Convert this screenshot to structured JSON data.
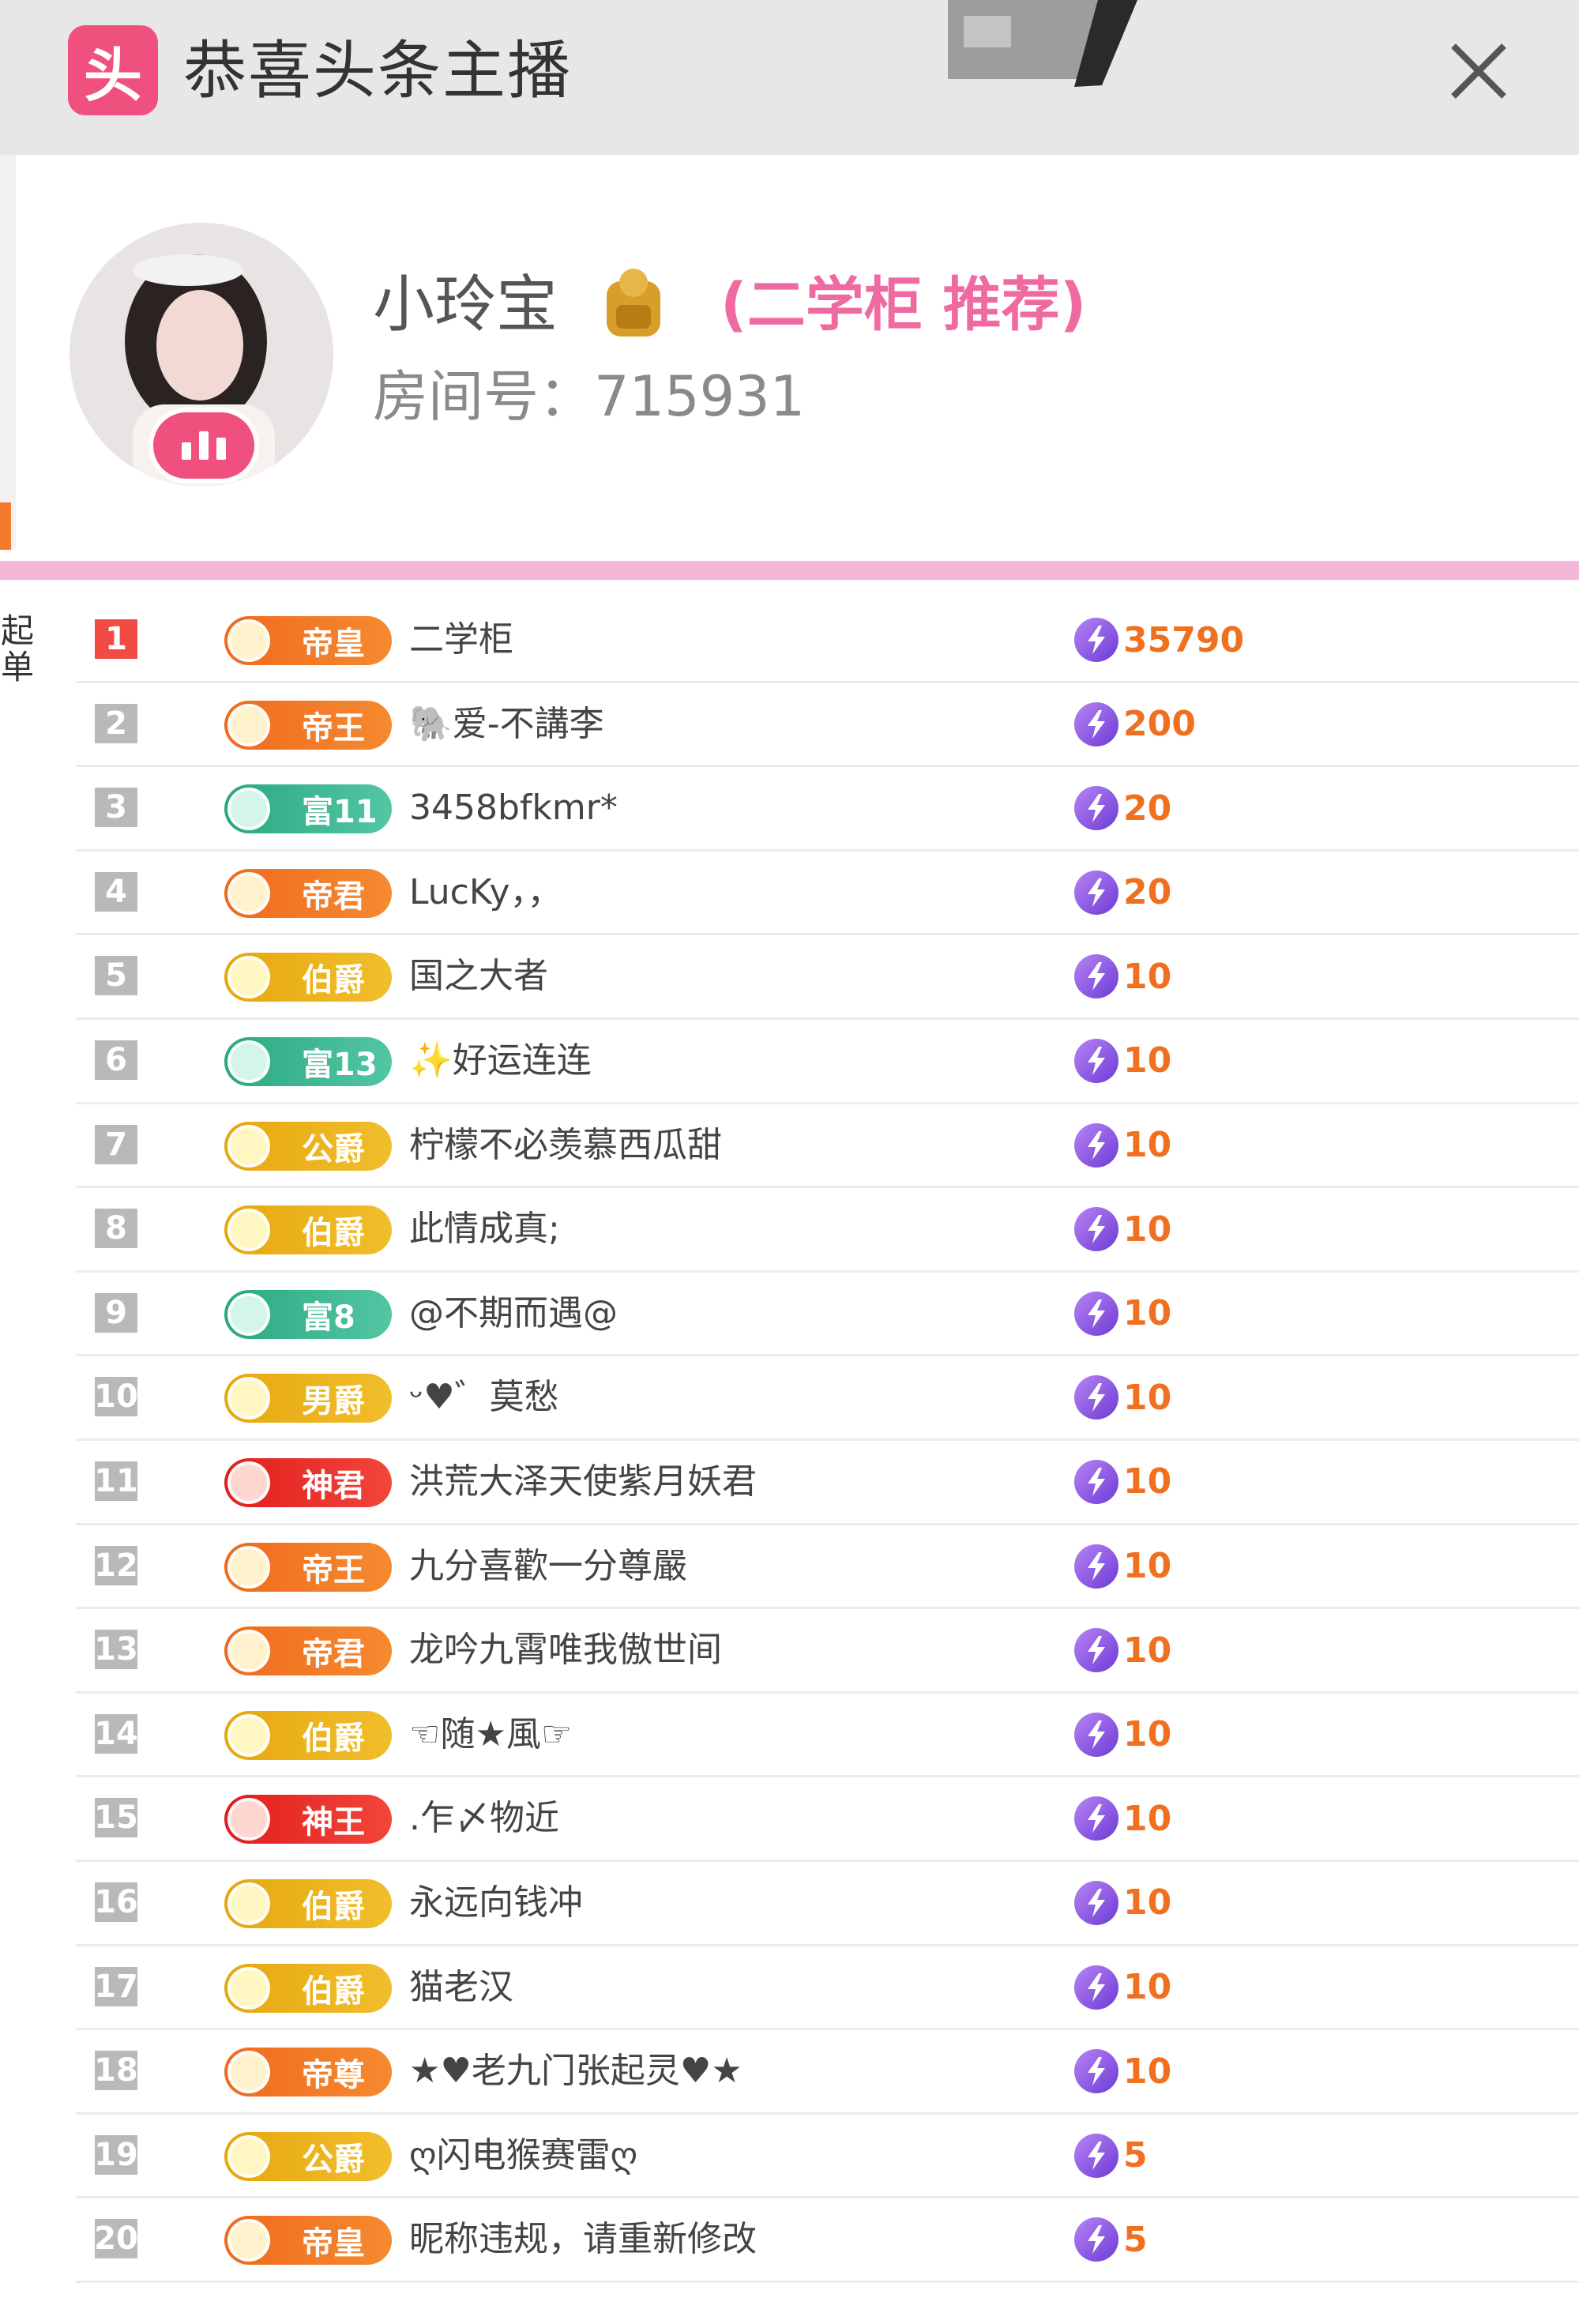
{
  "window": {
    "title": "恭喜头条主播",
    "app_icon_char": "头",
    "close_icon": "close-icon"
  },
  "host": {
    "name": "小玲宝",
    "recommend": "(二学柜 推荐)",
    "room": "房间号：715931",
    "stats_icon": "bar-chart-icon"
  },
  "side_tab": {
    "label_1": "起",
    "label_2": "单"
  },
  "ranking": [
    {
      "rank": "1",
      "level": "帝皇",
      "tier": "emperor",
      "name": "二学柜",
      "score": "35790"
    },
    {
      "rank": "2",
      "level": "帝王",
      "tier": "emperor",
      "name": "🐘爱-不講李",
      "score": "200"
    },
    {
      "rank": "3",
      "level": "富11",
      "tier": "rich",
      "name": "3458bfkmr*",
      "score": "20"
    },
    {
      "rank": "4",
      "level": "帝君",
      "tier": "emperor",
      "name": "LucKy，，",
      "score": "20"
    },
    {
      "rank": "5",
      "level": "伯爵",
      "tier": "noble",
      "name": "国之大者",
      "score": "10"
    },
    {
      "rank": "6",
      "level": "富13",
      "tier": "rich",
      "name": "✨好运连连",
      "score": "10"
    },
    {
      "rank": "7",
      "level": "公爵",
      "tier": "noble",
      "name": "柠檬不必羡慕西瓜甜",
      "score": "10"
    },
    {
      "rank": "8",
      "level": "伯爵",
      "tier": "noble",
      "name": "此情成真;",
      "score": "10"
    },
    {
      "rank": "9",
      "level": "富8",
      "tier": "rich",
      "name": "@不期而遇@",
      "score": "10"
    },
    {
      "rank": "10",
      "level": "男爵",
      "tier": "noble",
      "name": "ᵕ♥゛莫愁",
      "score": "10"
    },
    {
      "rank": "11",
      "level": "神君",
      "tier": "god",
      "name": "洪荒大泽天使紫月妖君",
      "score": "10"
    },
    {
      "rank": "12",
      "level": "帝王",
      "tier": "emperor",
      "name": "九分喜歡一分尊嚴",
      "score": "10"
    },
    {
      "rank": "13",
      "level": "帝君",
      "tier": "emperor",
      "name": "龙吟九霄唯我傲世间",
      "score": "10"
    },
    {
      "rank": "14",
      "level": "伯爵",
      "tier": "noble",
      "name": "☜随★風☞",
      "score": "10"
    },
    {
      "rank": "15",
      "level": "神王",
      "tier": "god",
      "name": ".乍〆物近",
      "score": "10"
    },
    {
      "rank": "16",
      "level": "伯爵",
      "tier": "noble",
      "name": "永远向钱冲",
      "score": "10"
    },
    {
      "rank": "17",
      "level": "伯爵",
      "tier": "noble",
      "name": "猫老汉",
      "score": "10"
    },
    {
      "rank": "18",
      "level": "帝尊",
      "tier": "emperor",
      "name": "★♥老九门张起灵♥★",
      "score": "10"
    },
    {
      "rank": "19",
      "level": "公爵",
      "tier": "noble",
      "name": "ღ闪电猴赛雷ღ",
      "score": "5"
    },
    {
      "rank": "20",
      "level": "帝皇",
      "tier": "emperor",
      "name": "昵称违规，请重新修改",
      "score": "5"
    }
  ]
}
